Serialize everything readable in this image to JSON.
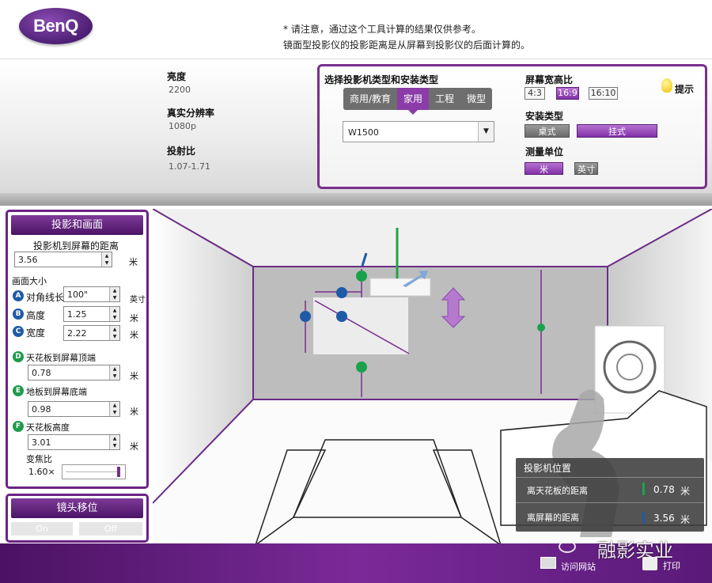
{
  "header": {
    "logo_text": "BenQ",
    "notice_line1": "* 请注意，通过这个工具计算的结果仅供参考。",
    "notice_line2": "镜面型投影仪的投影距离是从屏幕到投影仪的后面计算的。"
  },
  "specs": {
    "brightness_label": "亮度",
    "brightness_value": "2200",
    "resolution_label": "真实分辨率",
    "resolution_value": "1080p",
    "throw_label": "投射比",
    "throw_value": "1.07-1.71"
  },
  "selector": {
    "title": "选择投影机类型和安装类型",
    "tabs": [
      "商用/教育",
      "家用",
      "工程",
      "微型"
    ],
    "active_tab": "家用",
    "model_value": "W1500",
    "aspect_label": "屏幕宽高比",
    "aspect_options": [
      "4:3",
      "16:9",
      "16:10"
    ],
    "aspect_selected": "16:9",
    "tip_label": "提示",
    "mount_label": "安装类型",
    "mount_options": [
      "桌式",
      "挂式"
    ],
    "mount_selected": "挂式",
    "unit_label": "测量单位",
    "unit_options": [
      "米",
      "英寸"
    ],
    "unit_selected": "米"
  },
  "left_panel": {
    "title": "投影和画面",
    "distance_label": "投影机到屏幕的距离",
    "distance_value": "3.56",
    "distance_unit": "米",
    "image_size_label": "画面大小",
    "diagonal_badge": "A",
    "diagonal_label": "对角线长",
    "diagonal_value": "100\"",
    "diagonal_unit": "英寸",
    "height_badge": "B",
    "height_label": "高度",
    "height_value": "1.25",
    "height_unit": "米",
    "width_badge": "C",
    "width_label": "宽度",
    "width_value": "2.22",
    "width_unit": "米",
    "ceiling_top_badge": "D",
    "ceiling_top_label": "天花板到屏幕顶端",
    "ceiling_top_value": "0.78",
    "ceiling_top_unit": "米",
    "floor_bottom_badge": "E",
    "floor_bottom_label": "地板到屏幕底端",
    "floor_bottom_value": "0.98",
    "floor_bottom_unit": "米",
    "ceiling_height_badge": "F",
    "ceiling_height_label": "天花板高度",
    "ceiling_height_value": "3.01",
    "ceiling_height_unit": "米",
    "zoom_label": "变焦比",
    "zoom_value": "1.60×",
    "zoom_level": 0.97
  },
  "lens_panel": {
    "title": "镜头移位",
    "on_label": "On",
    "off_label": "Off"
  },
  "projector_position": {
    "title": "投影机位置",
    "ceiling_label": "离天花板的距离",
    "ceiling_value": "0.78",
    "ceiling_unit": "米",
    "screen_label": "离屏幕的距离",
    "screen_value": "3.56",
    "screen_unit": "米"
  },
  "footer": {
    "visit_label": "访问网站",
    "print_label": "打印",
    "watermark": "融影实业"
  },
  "colors": {
    "brand_purple": "#7b2f8f",
    "badge_blue": "#1f5aa6",
    "badge_green": "#1f9a4a",
    "marker_green": "#19a54a",
    "marker_blue": "#1f5aa6"
  }
}
